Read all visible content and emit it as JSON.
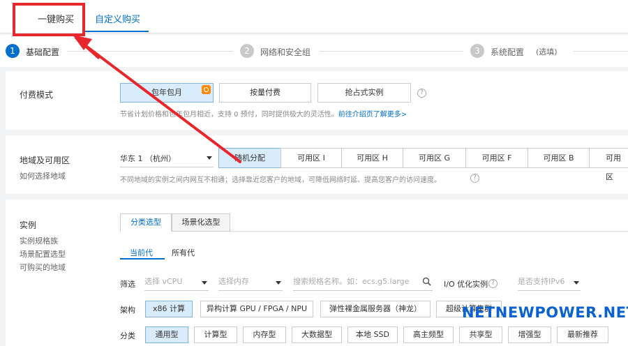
{
  "tabs": {
    "one_click": "一键购买",
    "custom": "自定义购买"
  },
  "steps": [
    {
      "num": "1",
      "label": "基础配置"
    },
    {
      "num": "2",
      "label": "网络和安全组"
    },
    {
      "num": "3",
      "label": "系统配置",
      "note": "(选填)"
    }
  ],
  "billing": {
    "label": "付费模式",
    "options": [
      "包年包月",
      "按量付费",
      "抢占式实例"
    ],
    "hint": "节省计划价格和包年包月相近，支持 0 预付，同时提供极大的灵活性。",
    "hint_link": "前往介绍页了解更多>"
  },
  "region": {
    "label": "地域及可用区",
    "sub": "如何选择地域",
    "selected": "华东 1 （杭州）",
    "zones": [
      "随机分配",
      "可用区 I",
      "可用区 H",
      "可用区 G",
      "可用区 F",
      "可用区 B",
      "可用区"
    ],
    "hint": "不同地域的实例之间内网互不相通；选择靠近您客户的地域，可降低网络时延、提高您客户的访问速度。"
  },
  "instance": {
    "label": "实例",
    "subs": [
      "实例规格族",
      "场景配置选型",
      "可购买的地域"
    ],
    "mode_tabs": [
      "分类选型",
      "场景化选型"
    ],
    "gen_tabs": [
      "当前代",
      "所有代"
    ],
    "filter_label": "筛选",
    "vcpu_placeholder": "选择 vCPU",
    "mem_placeholder": "选择内存",
    "search_placeholder": "搜索规格名称。如：ecs.g5.large",
    "io_label": "I/O 优化实例",
    "ipv6_placeholder": "是否支持IPv6",
    "arch_label": "架构",
    "arch_options": [
      "x86 计算",
      "异构计算 GPU / FPGA / NPU",
      "弹性裸金属服务器（神龙）",
      "超级计算集群"
    ],
    "cat_label": "分类",
    "cat_options": [
      "通用型",
      "计算型",
      "内存型",
      "大数据型",
      "本地 SSD",
      "高主频型",
      "共享型",
      "增强型",
      "最新推荐"
    ]
  },
  "watermark": "NETNEWPOWER.NET",
  "colors": {
    "accent": "#0070cc",
    "annotation": "#e8272c",
    "selected_bg": "#d9ecfb",
    "badge": "#ff8a00"
  }
}
